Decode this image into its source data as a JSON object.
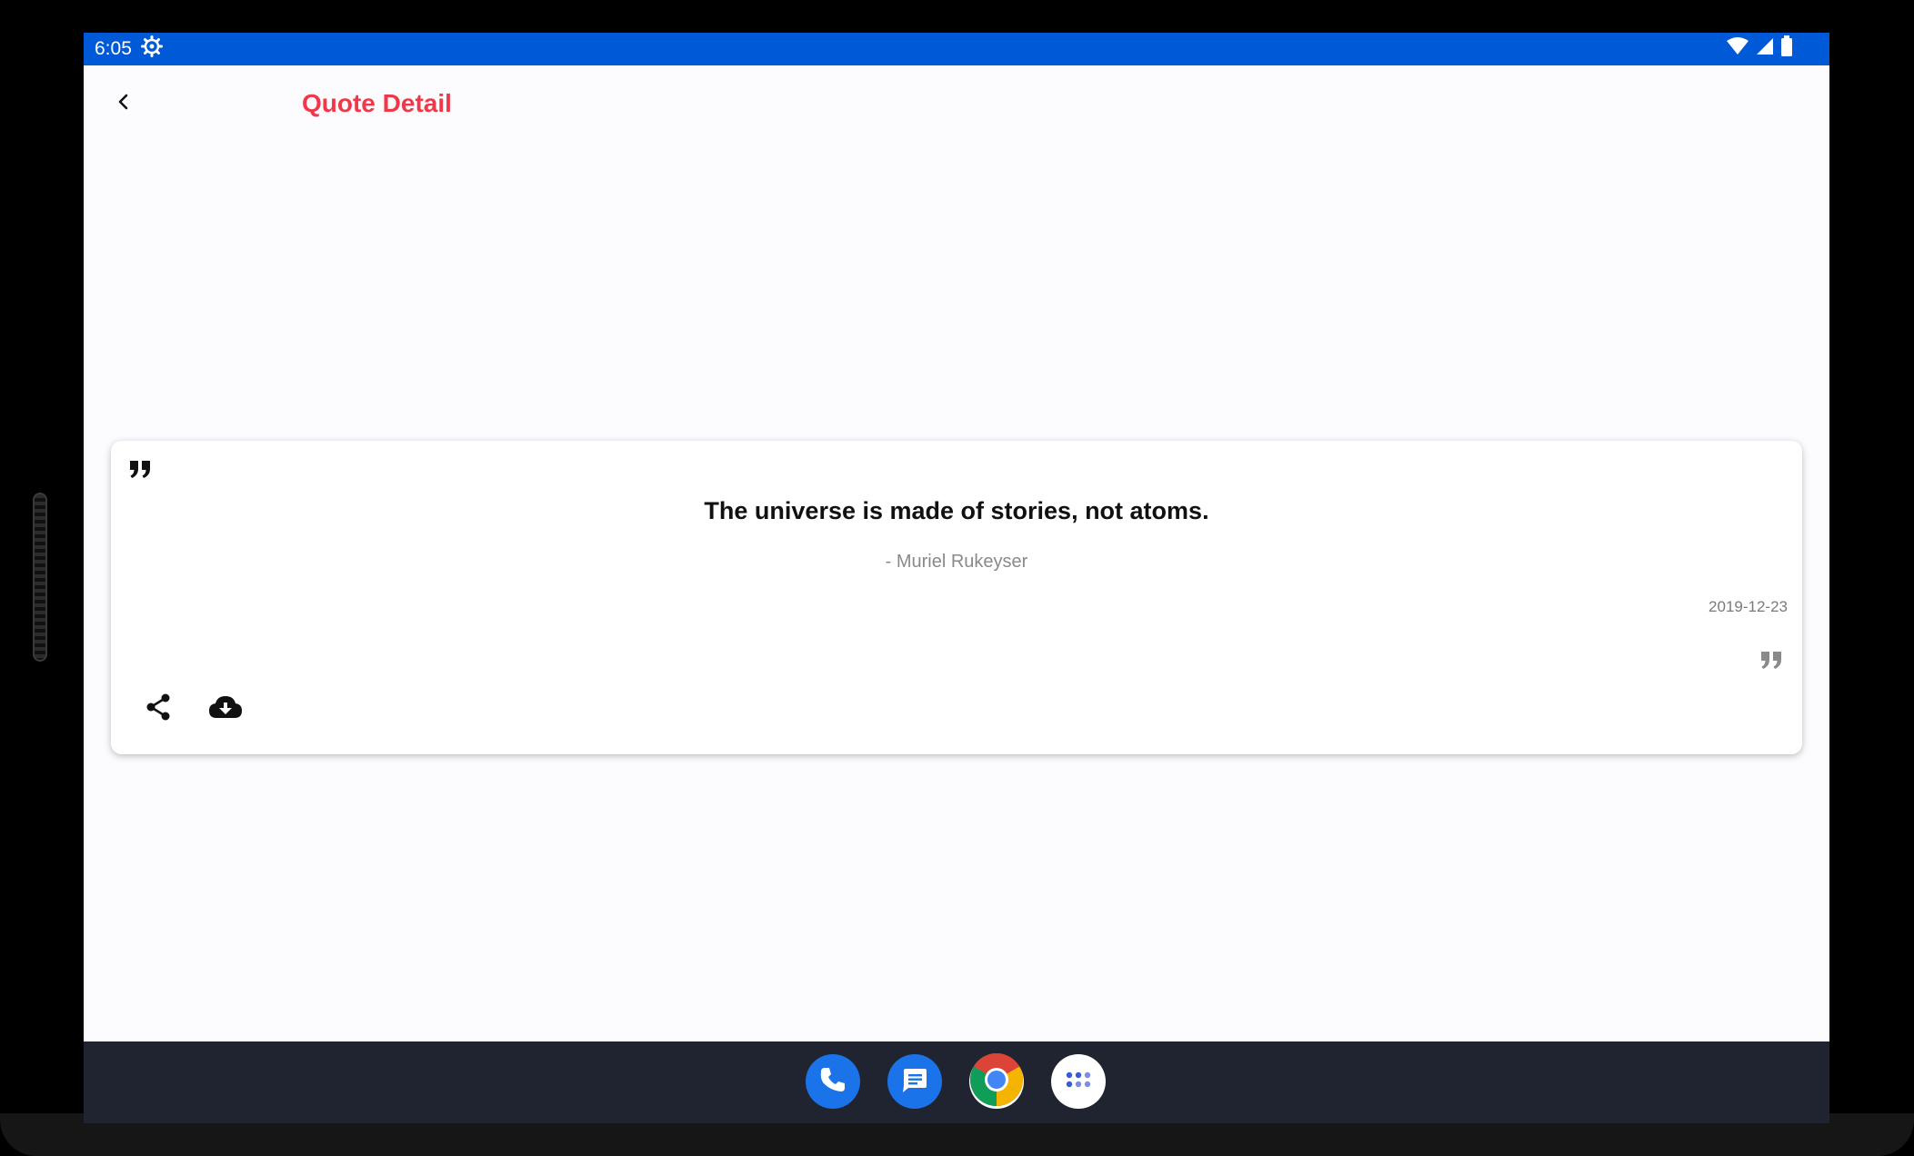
{
  "status_bar": {
    "time": "6:05",
    "icons": [
      "settings-gear-icon",
      "wifi-icon",
      "signal-icon",
      "battery-icon"
    ]
  },
  "app_bar": {
    "title": "Quote Detail",
    "back_icon": "chevron-left-icon",
    "title_color": "#f0384a"
  },
  "quote": {
    "text": "The universe is made of stories, not atoms.",
    "author": "- Muriel Rukeyser",
    "date": "2019-12-23",
    "open_icon": "open-quote-icon",
    "close_icon": "close-quote-icon"
  },
  "actions": [
    {
      "name": "share",
      "icon": "share-icon"
    },
    {
      "name": "download",
      "icon": "cloud-download-icon"
    }
  ],
  "dock": [
    {
      "name": "phone",
      "icon": "phone-icon",
      "color": "#1a73e8"
    },
    {
      "name": "messages",
      "icon": "messages-icon",
      "color": "#1a73e8"
    },
    {
      "name": "chrome",
      "icon": "chrome-icon",
      "color": "#ffffff"
    },
    {
      "name": "app-drawer",
      "icon": "apps-grid-icon",
      "color": "#ffffff"
    }
  ],
  "colors": {
    "status_bar": "#0059d6",
    "screen_background": "#fcfbfe",
    "nav_bar": "#1f2430",
    "accent": "#f0384a"
  }
}
